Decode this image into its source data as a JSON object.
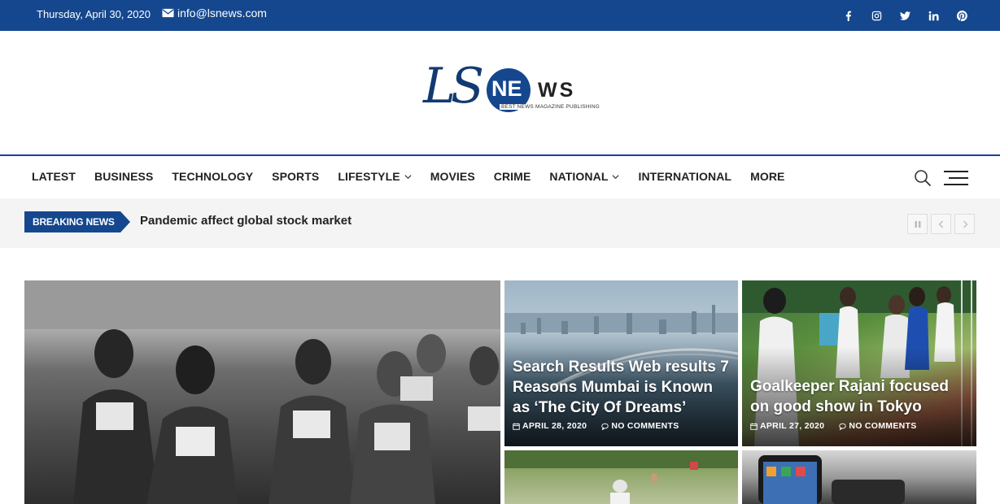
{
  "topbar": {
    "date": "Thursday, April 30, 2020",
    "email": "info@lsnews.com",
    "social": [
      "facebook-icon",
      "instagram-icon",
      "twitter-icon",
      "linkedin-icon",
      "pinterest-icon"
    ]
  },
  "logo": {
    "ls": "LS",
    "ne": "NE",
    "ws": "WS",
    "tagline": "BEST NEWS MAGAZINE PUBLISHING"
  },
  "nav": {
    "items": [
      {
        "label": "LATEST"
      },
      {
        "label": "BUSINESS"
      },
      {
        "label": "TECHNOLOGY"
      },
      {
        "label": "SPORTS"
      },
      {
        "label": "LIFESTYLE"
      },
      {
        "label": "MOVIES"
      },
      {
        "label": "CRIME"
      },
      {
        "label": "NATIONAL"
      },
      {
        "label": "INTERNATIONAL"
      },
      {
        "label": "MORE"
      }
    ]
  },
  "ticker": {
    "badge": "BREAKING NEWS",
    "headline": "Pandemic affect global stock market"
  },
  "featured": {
    "cards": [
      {
        "title": "Search Results Web results 7 Reasons Mumbai is Known as ‘The City Of Dreams’",
        "date": "APRIL 28, 2020",
        "comments": "NO COMMENTS"
      },
      {
        "title": "Goalkeeper Rajani focused on good show in Tokyo",
        "date": "APRIL 27, 2020",
        "comments": "NO COMMENTS"
      }
    ]
  },
  "colors": {
    "brand": "#15478e",
    "ticker_bg": "#f4f4f4"
  }
}
